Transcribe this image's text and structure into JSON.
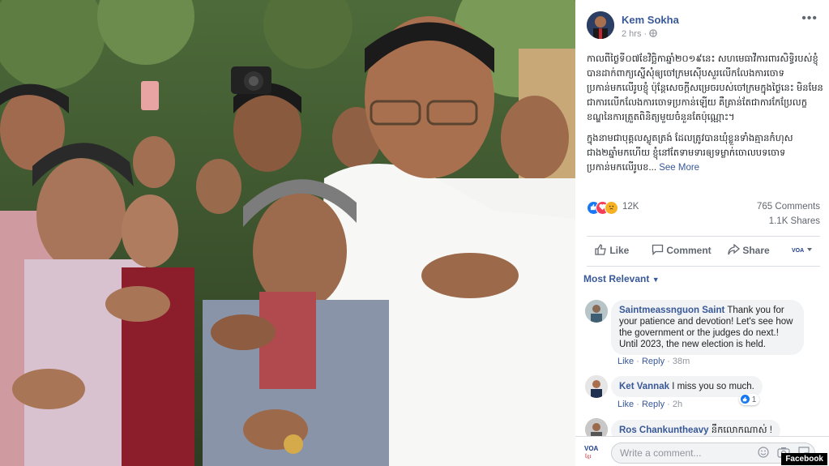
{
  "post": {
    "author": "Kem Sokha",
    "time": "2 hrs",
    "privacy_icon": "globe-icon",
    "more_icon": "•••",
    "text_p1": "កាលពីថ្ងៃទី០៧ខែវិច្ឆិកាឆ្នាំ២០១៩នេះ សហមេធាវីការពារសិទ្ធិរបស់ខ្ញុំបានដាក់ពាក្យស្នើសុំឲ្យចៅក្រមស៊ើបសួរលើកលែងការចោទប្រកាន់មកលើរូបខ្ញុំ ប៉ុន្តែសេចក្តីសម្រេចរបស់ចៅក្រមក្នុងថ្ងៃនេះ មិនមែនជាការលើកលែងការចោទប្រកាន់ឡើយ គឺគ្រាន់តែជាការកែប្រែលក្ខខណ្ឌនៃការត្រួតពិនិត្យមួយចំនួនតែប៉ុណ្ណោះ។",
    "text_p2": "ក្នុងនាមជាបុគ្គលស្លូតត្រង់ ដែលត្រូវបានឃុំខ្លួនទាំងគ្មានកំហុសជាង២ឆ្នាំមកហើយ ខ្ញុំនៅតែទាមទារឲ្យទម្លាក់ចោលបទចោទប្រកាន់មកលើរូបខ...",
    "see_more": "See More"
  },
  "reactions": {
    "icons": [
      "like-icon",
      "love-icon",
      "sad-icon"
    ],
    "count": "12K",
    "comments": "765 Comments",
    "shares": "1.1K Shares"
  },
  "actions": {
    "like": "Like",
    "comment": "Comment",
    "share": "Share"
  },
  "sort_label": "Most Relevant",
  "comments": [
    {
      "name": "Saintmeassnguon Saint",
      "text": "Thank you for your patience and devotion! Let's see how the government or the judges do next.! Until 2023, the new election is held.",
      "like": "Like",
      "reply": "Reply",
      "time": "38m"
    },
    {
      "name": "Ket Vannak",
      "text": "I miss you so much.",
      "like": "Like",
      "reply": "Reply",
      "time": "2h",
      "likes": "1"
    },
    {
      "name": "Ros Chankuntheavy",
      "text": "នឹកលោកណាស់ !"
    }
  ],
  "write": {
    "placeholder": "Write a comment...",
    "page_label": "VOA",
    "page_sublabel": "ខ្មែរ"
  },
  "watermark": "Facebook",
  "colors": {
    "link": "#385898",
    "like_blue": "#1877f2",
    "love_red": "#f33e58",
    "sad_yellow": "#f7b125"
  }
}
